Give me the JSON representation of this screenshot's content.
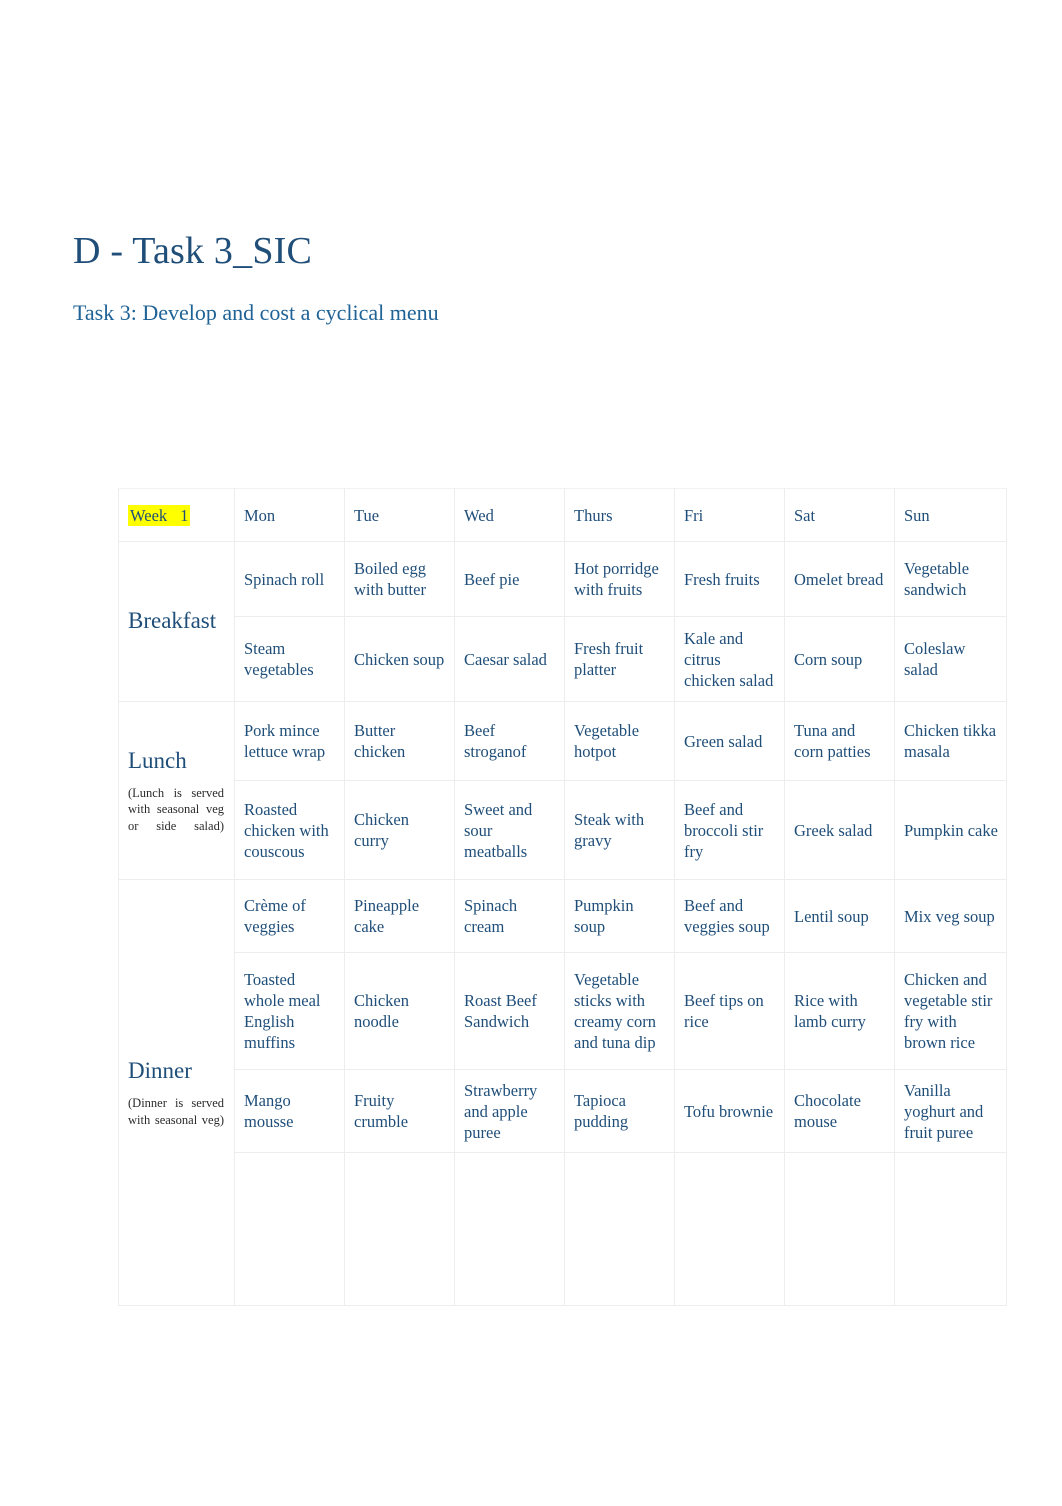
{
  "document": {
    "title": "D - Task 3_SIC",
    "subtitle": "Task 3: Develop and cost a cyclical menu"
  },
  "table": {
    "week_label": {
      "word": "Week",
      "number": "1",
      "full": "Week 1",
      "highlight_color": "#FFFF00"
    },
    "days": [
      "Mon",
      "Tue",
      "Wed",
      "Thurs",
      "Fri",
      "Sat",
      "Sun"
    ],
    "sections": [
      {
        "label": "Breakfast",
        "note": "",
        "rows": [
          [
            "Spinach roll",
            "Boiled egg with butter",
            "Beef pie",
            "Hot porridge with fruits",
            "Fresh fruits",
            "Omelet bread",
            "Vegetable sandwich"
          ],
          [
            "Steam vegetables",
            "Chicken soup",
            "Caesar salad",
            "Fresh fruit platter",
            "Kale and citrus chicken salad",
            "Corn soup",
            "Coleslaw salad"
          ]
        ]
      },
      {
        "label": "Lunch",
        "note": "(Lunch is served with seasonal veg or side salad)",
        "rows": [
          [
            "Pork mince lettuce wrap",
            "Butter chicken",
            "Beef stroganof",
            "Vegetable hotpot",
            "Green salad",
            "Tuna and corn patties",
            "Chicken tikka masala"
          ],
          [
            "Roasted chicken with couscous",
            "Chicken curry",
            "Sweet and sour meatballs",
            "Steak with gravy",
            "Beef and broccoli stir fry",
            "Greek salad",
            "Pumpkin cake"
          ]
        ]
      },
      {
        "label": "Dinner",
        "note": "(Dinner is served with seasonal veg)",
        "rows": [
          [
            "Crème of veggies",
            "Pineapple cake",
            "Spinach cream",
            "Pumpkin soup",
            "Beef and veggies soup",
            "Lentil soup",
            "Mix veg soup"
          ],
          [
            "Toasted whole meal English muffins",
            "Chicken noodle",
            "Roast Beef Sandwich",
            "Vegetable sticks with creamy corn and tuna dip",
            "Beef tips on rice",
            "Rice with lamb curry",
            "Chicken and vegetable stir fry with brown rice"
          ],
          [
            "Mango mousse",
            "Fruity crumble",
            "Strawberry and apple puree",
            "Tapioca pudding",
            "Tofu brownie",
            "Chocolate mouse",
            "Vanilla yoghurt and fruit puree"
          ]
        ]
      }
    ],
    "colors": {
      "text": "#1F4E79",
      "note_text": "#2B2B2B",
      "border": "#EDEDED",
      "highlight": "#FFFF00"
    }
  }
}
